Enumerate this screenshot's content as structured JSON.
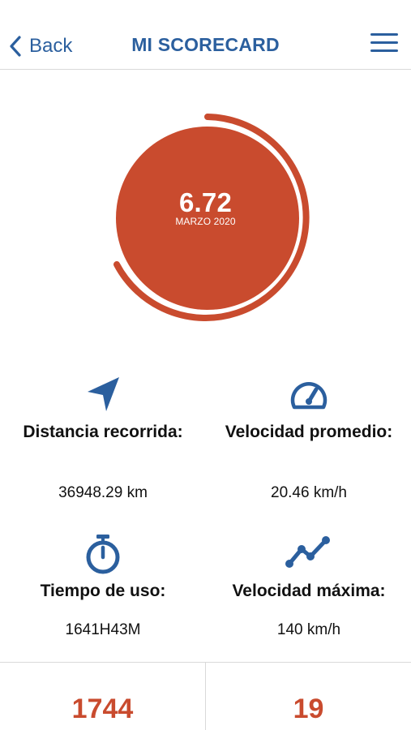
{
  "header": {
    "back_label": "Back",
    "title": "MI SCORECARD",
    "back_icon": "chevron-left-icon",
    "menu_icon": "hamburger-menu-icon"
  },
  "score": {
    "value": "6.72",
    "period": "MARZO 2020",
    "ring_color": "#c94b2e"
  },
  "stats": [
    {
      "icon": "navigation-arrow-icon",
      "label": "Distancia recorrida:",
      "value": "36948.29 km"
    },
    {
      "icon": "speedometer-icon",
      "label": "Velocidad promedio:",
      "value": "20.46 km/h"
    },
    {
      "icon": "stopwatch-icon",
      "label": "Tiempo de uso:",
      "value": "1641H43M"
    },
    {
      "icon": "trend-line-icon",
      "label": "Velocidad máxima:",
      "value": "140 km/h"
    }
  ],
  "bottom": {
    "left_value": "1744",
    "right_value": "19"
  },
  "colors": {
    "primary_blue": "#2b5f9e",
    "accent_orange": "#c94b2e",
    "divider": "#d9d9d9",
    "background": "#ffffff"
  }
}
